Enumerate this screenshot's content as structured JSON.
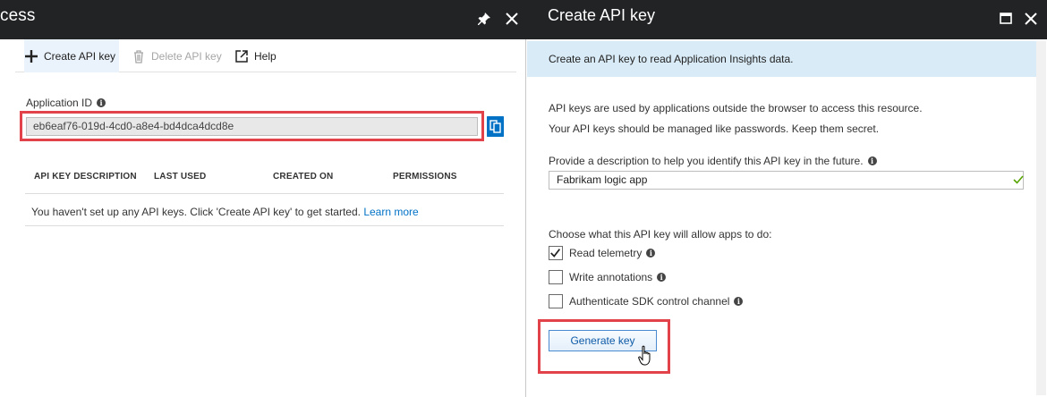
{
  "left_blade": {
    "title": "cess",
    "toolbar": {
      "create_label": "Create API key",
      "delete_label": "Delete API key",
      "help_label": "Help"
    },
    "app_id": {
      "label": "Application ID",
      "value": "eb6eaf76-019d-4cd0-a8e4-bd4dca4dcd8e"
    },
    "table": {
      "headers": [
        "API KEY DESCRIPTION",
        "LAST USED",
        "CREATED ON",
        "PERMISSIONS"
      ],
      "empty_message": "You haven't set up any API keys. Click 'Create API key' to get started.",
      "learn_more": "Learn more"
    }
  },
  "right_blade": {
    "title": "Create API key",
    "banner": "Create an API key to read Application Insights data.",
    "desc_line_1": "API keys are used by applications outside the browser to access this resource.",
    "desc_line_2": "Your API keys should be managed like passwords. Keep them secret.",
    "description_label": "Provide a description to help you identify this API key in the future.",
    "description_value": "Fabrikam logic app",
    "permissions_label": "Choose what this API key will allow apps to do:",
    "permissions": [
      {
        "label": "Read telemetry",
        "checked": true
      },
      {
        "label": "Write annotations",
        "checked": false
      },
      {
        "label": "Authenticate SDK control channel",
        "checked": false
      }
    ],
    "generate_label": "Generate key"
  },
  "colors": {
    "header_bg": "#222325",
    "accent": "#0072c6",
    "highlight": "#e2434b",
    "banner_bg": "#d9ebf7"
  }
}
